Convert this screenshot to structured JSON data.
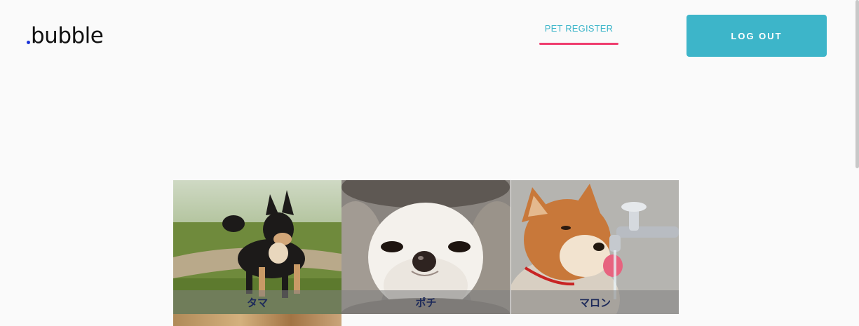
{
  "brand": {
    "logo_text": "bubble",
    "dot_color": "#1a33d8"
  },
  "nav": {
    "pet_register_label": "PET REGISTER",
    "active_underline_color": "#ef3d6e"
  },
  "header": {
    "logout_label": "LOG OUT",
    "accent_color": "#3db5c9"
  },
  "pets": [
    {
      "name": "タマ",
      "image": "black-shiba-dog-photo"
    },
    {
      "name": "ポチ",
      "image": "white-chihuahua-photo"
    },
    {
      "name": "マロン",
      "image": "red-shiba-drinking-photo"
    }
  ]
}
